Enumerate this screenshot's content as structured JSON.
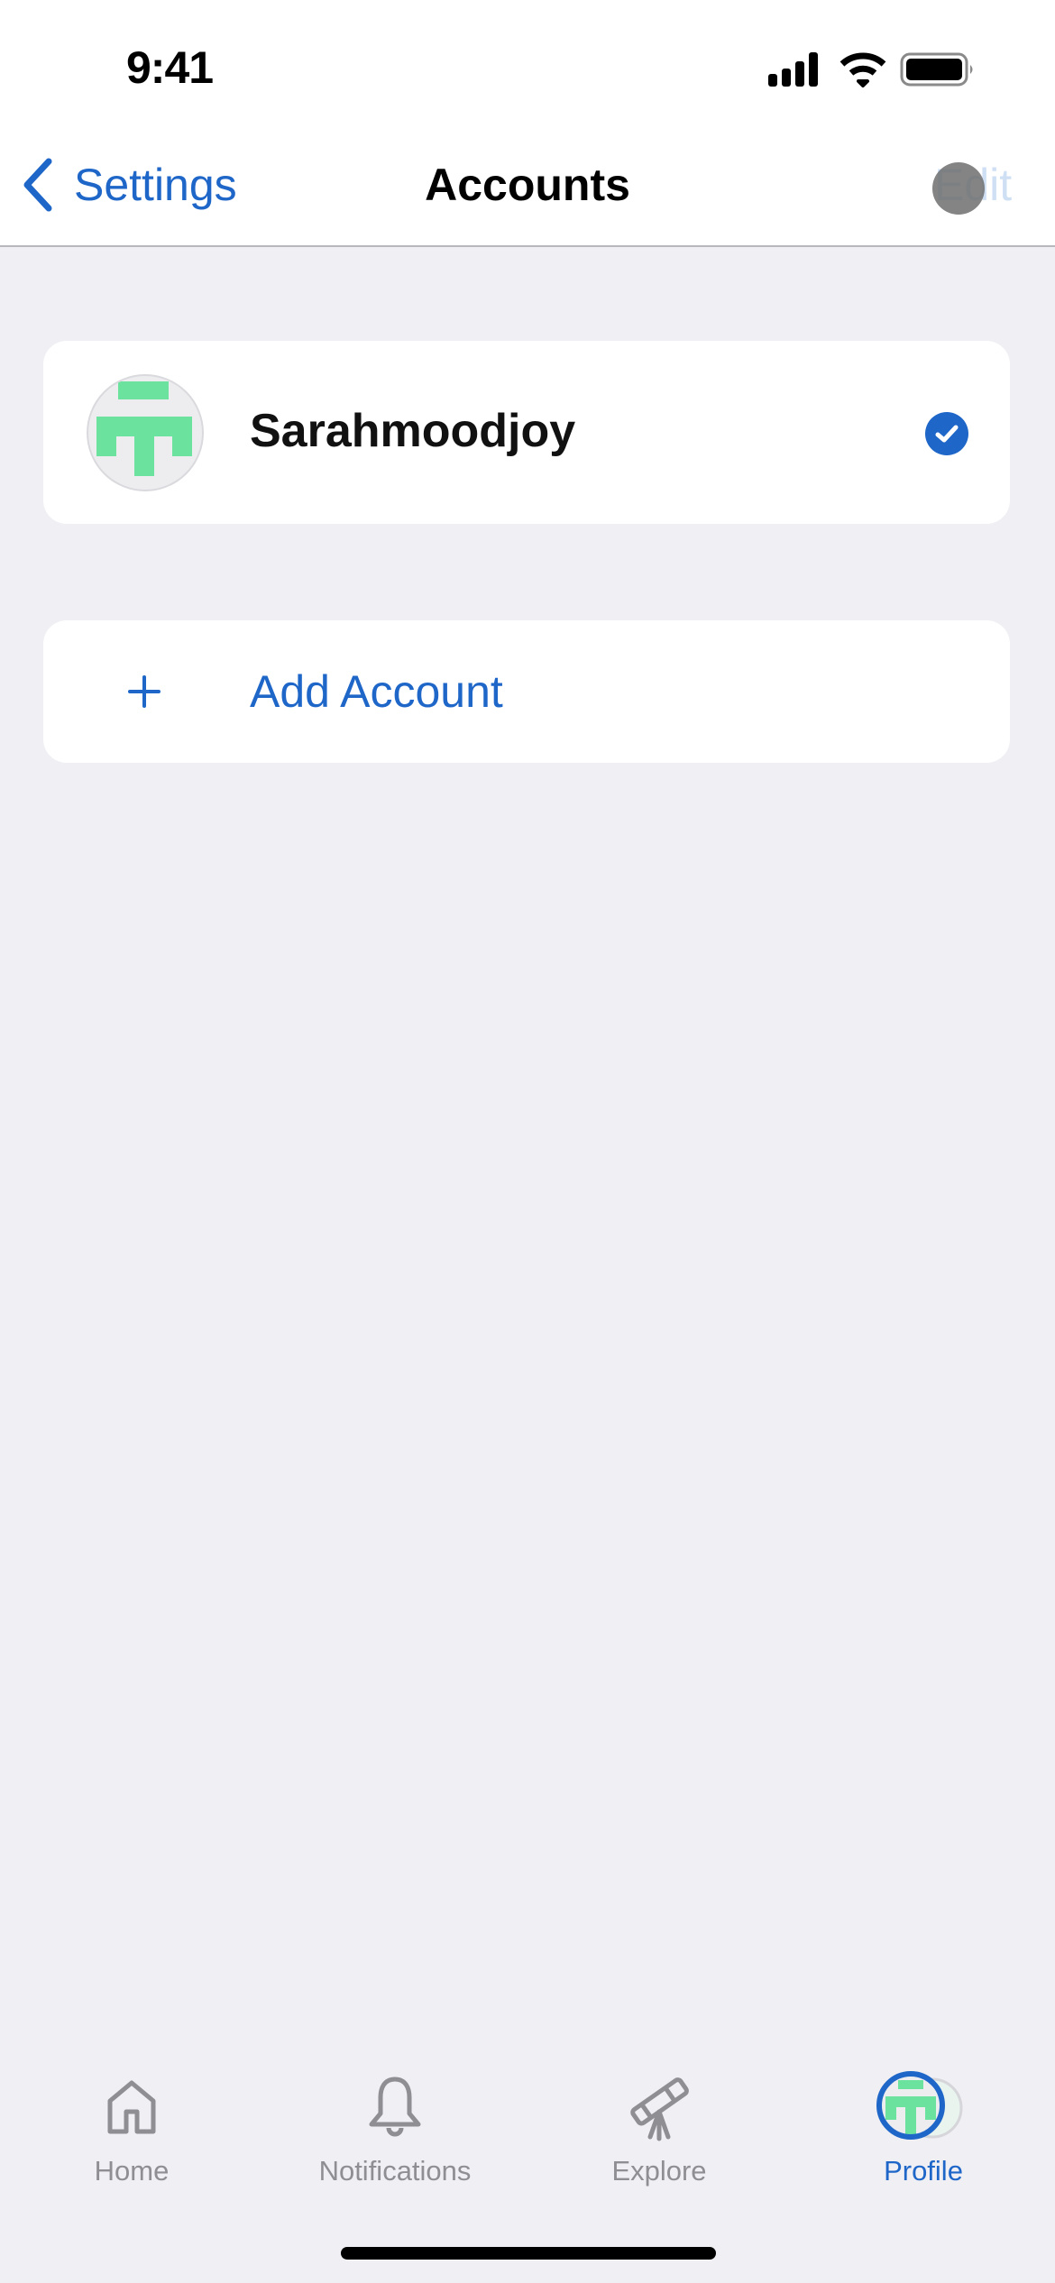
{
  "status_bar": {
    "time": "9:41",
    "icons": [
      "signal-icon",
      "wifi-icon",
      "battery-icon"
    ]
  },
  "nav": {
    "back_label": "Settings",
    "title": "Accounts",
    "edit_label": "Edit"
  },
  "accounts": [
    {
      "name": "Sarahmoodjoy",
      "selected": true,
      "avatar_color": "#6BE39E"
    }
  ],
  "add_account": {
    "icon": "plus-icon",
    "label": "Add Account"
  },
  "tab_bar": {
    "items": [
      {
        "label": "Home",
        "icon": "house-icon",
        "active": false
      },
      {
        "label": "Notifications",
        "icon": "bell-icon",
        "active": false
      },
      {
        "label": "Explore",
        "icon": "telescope-icon",
        "active": false
      },
      {
        "label": "Profile",
        "icon": "avatar-icon",
        "active": true
      }
    ]
  },
  "colors": {
    "accent": "#1E66C8",
    "background": "#EFEFF4",
    "inactive": "#8E8E93",
    "avatar_green": "#6BE39E"
  }
}
